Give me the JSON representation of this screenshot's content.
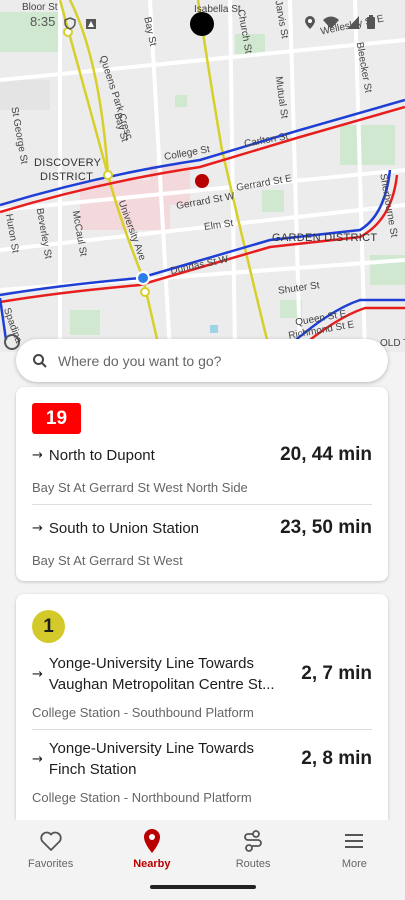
{
  "status": {
    "time": "8:35"
  },
  "map": {
    "labels": {
      "bloor": "Bloor St",
      "bay_top": "Bay St",
      "church": "Church St",
      "jarvis": "Jarvis St",
      "wellesley": "Wellesley St E",
      "bleecker": "Bleecker St",
      "queens_park": "Queens Park Cresc",
      "bella": "Isabella St",
      "mutual": "Mutual St",
      "st_george": "St George St",
      "college": "College St",
      "carlton": "Carlton St",
      "discovery": "DISCOVERY",
      "district": "DISTRICT",
      "gerrard_w": "Gerrard St W",
      "gerrard_e": "Gerrard St E",
      "sherbourne": "Sherbourne St",
      "university": "University Ave",
      "elm": "Elm St",
      "garden": "GARDEN DISTRICT",
      "huron": "Huron St",
      "beverley": "Beverley St",
      "mccaul": "McCaul St",
      "bay": "Bay St",
      "dundas": "Dundas St W",
      "shuter": "Shuter St",
      "queen": "Queen St E",
      "richmond": "Richmond St E",
      "spadina": "Spadina",
      "old_town": "OLD T"
    }
  },
  "search": {
    "placeholder": "Where do you want to go?"
  },
  "cards": [
    {
      "route": "19",
      "directions": [
        {
          "name": "North to Dupont",
          "time": "20, 44 min",
          "stop": "Bay St At Gerrard St West North Side"
        },
        {
          "name": "South to Union Station",
          "time": "23, 50 min",
          "stop": "Bay St At Gerrard St West"
        }
      ]
    },
    {
      "route": "1",
      "directions": [
        {
          "name_line1": "Yonge-University Line Towards",
          "name_line2": "Vaughan Metropolitan Centre St...",
          "time": "2, 7 min",
          "stop": "College Station - Southbound Platform"
        },
        {
          "name_line1": "Yonge-University Line Towards",
          "name_line2": "Finch Station",
          "time": "2, 8 min",
          "stop": "College Station - Northbound Platform"
        }
      ]
    }
  ],
  "nav": {
    "favorites": "Favorites",
    "nearby": "Nearby",
    "routes": "Routes",
    "more": "More"
  },
  "colors": {
    "accent": "#b80000",
    "route_red": "#ff0000",
    "subway_yellow": "#d4c92b"
  }
}
